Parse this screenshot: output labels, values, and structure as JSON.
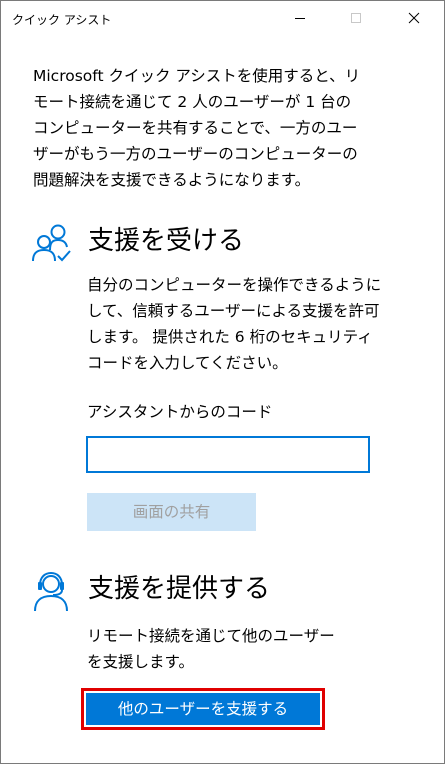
{
  "window": {
    "title": "クイック アシスト"
  },
  "intro": {
    "line1": "Microsoft クイック アシストを使用すると、リ",
    "line2": "モート接続を通じて 2 人のユーザーが 1 台の",
    "line3": "コンピューターを共有することで、一方のユー",
    "line4": "ザーがもう一方のユーザーのコンピューターの",
    "line5": "問題解決を支援できるようになります。"
  },
  "receive": {
    "heading": "支援を受ける",
    "desc_line1": "自分のコンピューターを操作できるように",
    "desc_line2": "して、信頼するユーザーによる支援を許可",
    "desc_line3": "します。 提供された 6 桁のセキュリティ",
    "desc_line4": "コードを入力してください。",
    "code_label": "アシスタントからのコード",
    "code_value": "",
    "share_button": "画面の共有"
  },
  "give": {
    "heading": "支援を提供する",
    "desc_line1": "リモート接続を通じて他のユーザー",
    "desc_line2": "を支援します。",
    "assist_button": "他のユーザーを支援する"
  },
  "colors": {
    "accent": "#0078d7",
    "disabled_button_bg": "#cce4f7",
    "disabled_button_text": "#a0a0a0",
    "highlight": "#e00000"
  },
  "icons": {
    "minimize": "minimize-icon",
    "maximize": "maximize-icon",
    "close": "close-icon",
    "receive": "people-check-icon",
    "give": "headset-person-icon"
  }
}
